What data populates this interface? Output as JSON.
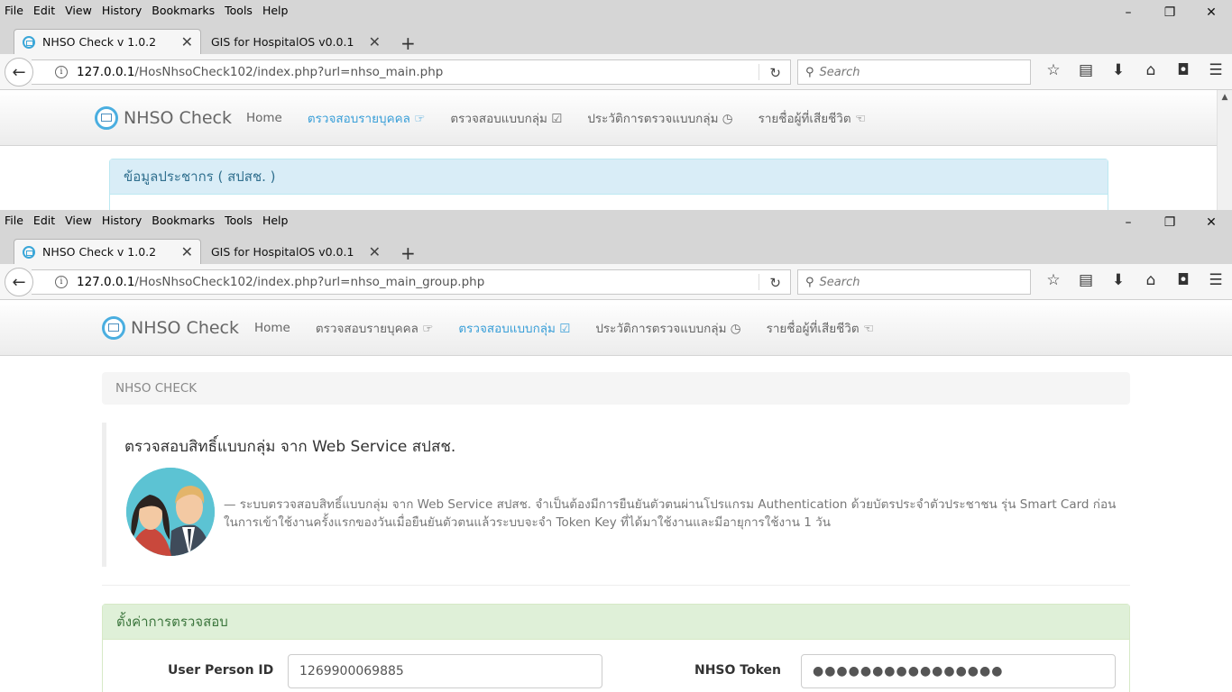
{
  "menu": [
    "File",
    "Edit",
    "View",
    "History",
    "Bookmarks",
    "Tools",
    "Help"
  ],
  "window_controls": {
    "minimize": "–",
    "restore": "❐",
    "close": "✕"
  },
  "tabs": [
    {
      "title": "NHSO Check v 1.0.2"
    },
    {
      "title": "GIS for HospitalOS v0.0.1"
    }
  ],
  "search_placeholder": "Search",
  "top_window": {
    "url_host": "127.0.0.1",
    "url_path": "/HosNhsoCheck102/index.php?url=nhso_main.php",
    "active_nav": 1,
    "panel_title": "ข้อมูลประชากร ( สปสช. )"
  },
  "bottom_window": {
    "url_host": "127.0.0.1",
    "url_path": "/HosNhsoCheck102/index.php?url=nhso_main_group.php",
    "active_nav": 2,
    "breadcrumb": "NHSO CHECK",
    "intro_title": "ตรวจสอบสิทธิ์แบบกลุ่ม จาก Web Service สปสช.",
    "intro_text": "— ระบบตรวจสอบสิทธิ์แบบกลุ่ม จาก Web Service สปสช. จำเป็นต้องมีการยืนยันตัวตนผ่านโปรแกรม Authentication ด้วยบัตรประจำตัวประชาชน รุ่น Smart Card ก่อนในการเข้าใช้งานครั้งแรกของวันเมื่อยืนยันตัวตนแล้วระบบจะจำ Token Key ที่ได้มาใช้งานและมีอายุการใช้งาน 1 วัน",
    "settings_title": "ตั้งค่าการตรวจสอบ",
    "person_id_label": "User Person ID",
    "person_id_value": "1269900069885",
    "token_label": "NHSO Token",
    "token_value": "●●●●●●●●●●●●●●●●"
  },
  "site": {
    "brand": "NHSO Check",
    "nav": [
      "Home",
      "ตรวจสอบรายบุคคล ☞",
      "ตรวจสอบแบบกลุ่ม ☑",
      "ประวัติการตรวจแบบกลุ่ม ◷",
      "รายชื่อผู้ที่เสียชีวิต ☜"
    ]
  },
  "colors": {
    "accent": "#3a9fd8",
    "info_header": "#d9edf7",
    "success_header": "#dff0d8"
  }
}
